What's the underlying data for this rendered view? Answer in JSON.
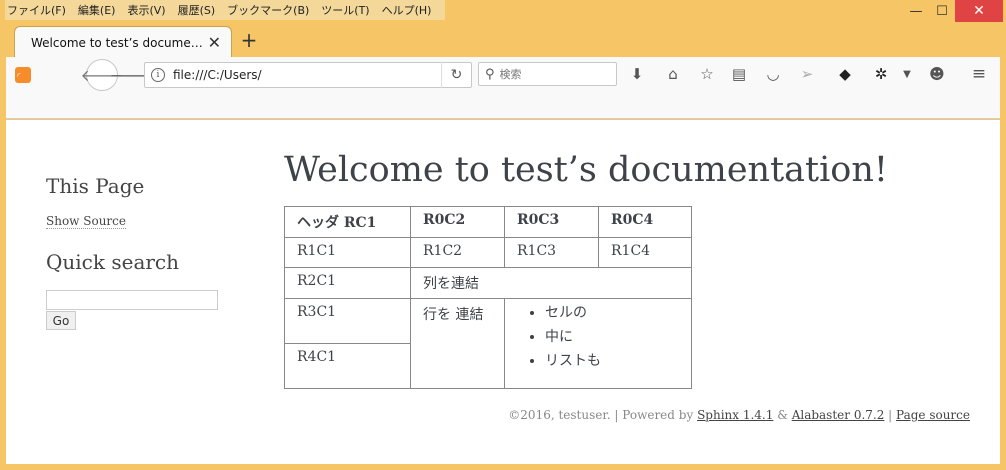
{
  "menu": [
    "ファイル(F)",
    "編集(E)",
    "表示(V)",
    "履歴(S)",
    "ブックマーク(B)",
    "ツール(T)",
    "ヘルプ(H)"
  ],
  "window": {
    "minimize": "—",
    "maximize": "☐",
    "close": "✕"
  },
  "tab": {
    "title": "Welcome to test’s docume…",
    "close": "✕",
    "new_tab": "+"
  },
  "toolbar": {
    "url": "file:///C:/Users/",
    "search_placeholder": "検索",
    "icons": [
      "download-icon",
      "home-icon",
      "bookmark-star-icon",
      "reading-list-icon",
      "pocket-icon",
      "send-icon",
      "cloud-icon",
      "extension-icon",
      "dropdown-icon",
      "emoji-icon",
      "menu-icon"
    ]
  },
  "sidebar": {
    "this_page": "This Page",
    "show_source": "Show Source",
    "quick_search": "Quick search",
    "go_button": "Go",
    "search_value": ""
  },
  "main": {
    "title": "Welcome to test’s documentation!",
    "table": {
      "header": [
        "ヘッダ RC1",
        "R0C2",
        "R0C3",
        "R0C4"
      ],
      "row1": [
        "R1C1",
        "R1C2",
        "R1C3",
        "R1C4"
      ],
      "row2": [
        "R2C1",
        "列を連結"
      ],
      "row3_c1": "R3C1",
      "row3_merged": "行を 連結",
      "list": [
        "セルの",
        "中に",
        "リストも"
      ],
      "row4_c1": "R4C1"
    }
  },
  "footer": {
    "copyright": "©2016, testuser. | Powered by ",
    "sphinx": "Sphinx 1.4.1",
    "amp": " & ",
    "alabaster": "Alabaster 0.7.2",
    "sep": " | ",
    "page_source": "Page source"
  }
}
